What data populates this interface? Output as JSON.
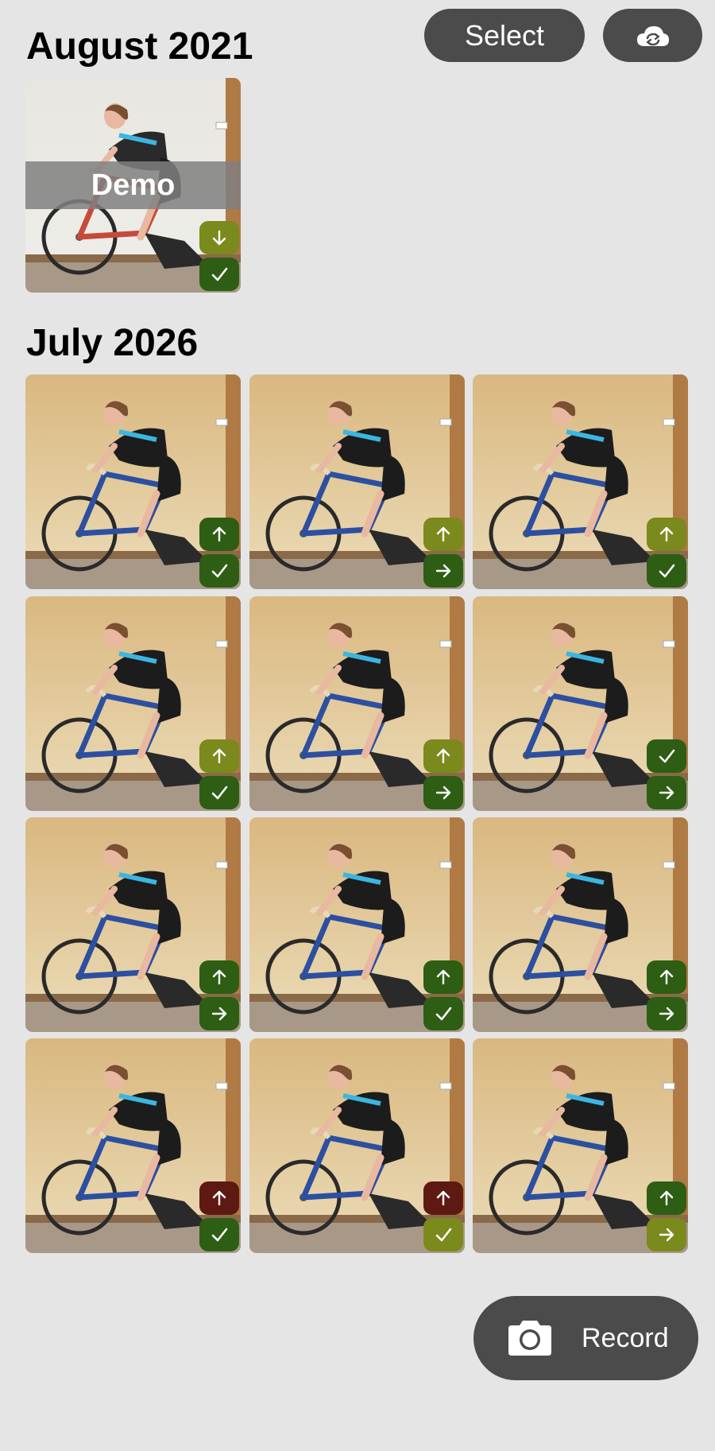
{
  "toolbar": {
    "select_label": "Select",
    "cloud_icon": "cloud-sync-icon"
  },
  "sections": [
    {
      "title": "August 2021"
    },
    {
      "title": "July 2026"
    }
  ],
  "demo_tile": {
    "label": "Demo",
    "badges": [
      {
        "icon": "arrow-down",
        "color": "#7a8a1c"
      },
      {
        "icon": "check",
        "color": "#2d5e14"
      }
    ]
  },
  "videos": [
    {
      "badges": [
        {
          "icon": "arrow-up",
          "color": "#2d5e14"
        },
        {
          "icon": "check",
          "color": "#2d5e14"
        }
      ]
    },
    {
      "badges": [
        {
          "icon": "arrow-up",
          "color": "#7a8a1c"
        },
        {
          "icon": "arrow-right",
          "color": "#2d5e14"
        }
      ]
    },
    {
      "badges": [
        {
          "icon": "arrow-up",
          "color": "#7a8a1c"
        },
        {
          "icon": "check",
          "color": "#2d5e14"
        }
      ]
    },
    {
      "badges": [
        {
          "icon": "arrow-up",
          "color": "#7a8a1c"
        },
        {
          "icon": "check",
          "color": "#2d5e14"
        }
      ]
    },
    {
      "badges": [
        {
          "icon": "arrow-up",
          "color": "#7a8a1c"
        },
        {
          "icon": "arrow-right",
          "color": "#2d5e14"
        }
      ]
    },
    {
      "badges": [
        {
          "icon": "check",
          "color": "#2d5e14"
        },
        {
          "icon": "arrow-right",
          "color": "#2d5e14"
        }
      ]
    },
    {
      "badges": [
        {
          "icon": "arrow-up",
          "color": "#2d5e14"
        },
        {
          "icon": "arrow-right",
          "color": "#2d5e14"
        }
      ]
    },
    {
      "badges": [
        {
          "icon": "arrow-up",
          "color": "#2d5e14"
        },
        {
          "icon": "check",
          "color": "#2d5e14"
        }
      ]
    },
    {
      "badges": [
        {
          "icon": "arrow-up",
          "color": "#2d5e14"
        },
        {
          "icon": "arrow-right",
          "color": "#2d5e14"
        }
      ]
    },
    {
      "badges": [
        {
          "icon": "arrow-up",
          "color": "#5e1a12"
        },
        {
          "icon": "check",
          "color": "#2d5e14"
        }
      ]
    },
    {
      "badges": [
        {
          "icon": "arrow-up",
          "color": "#5e1a12"
        },
        {
          "icon": "check",
          "color": "#7a8a1c"
        }
      ]
    },
    {
      "badges": [
        {
          "icon": "arrow-up",
          "color": "#2d5e14"
        },
        {
          "icon": "arrow-right",
          "color": "#7a8a1c"
        }
      ]
    }
  ],
  "record": {
    "label": "Record",
    "icon": "camera-icon"
  }
}
